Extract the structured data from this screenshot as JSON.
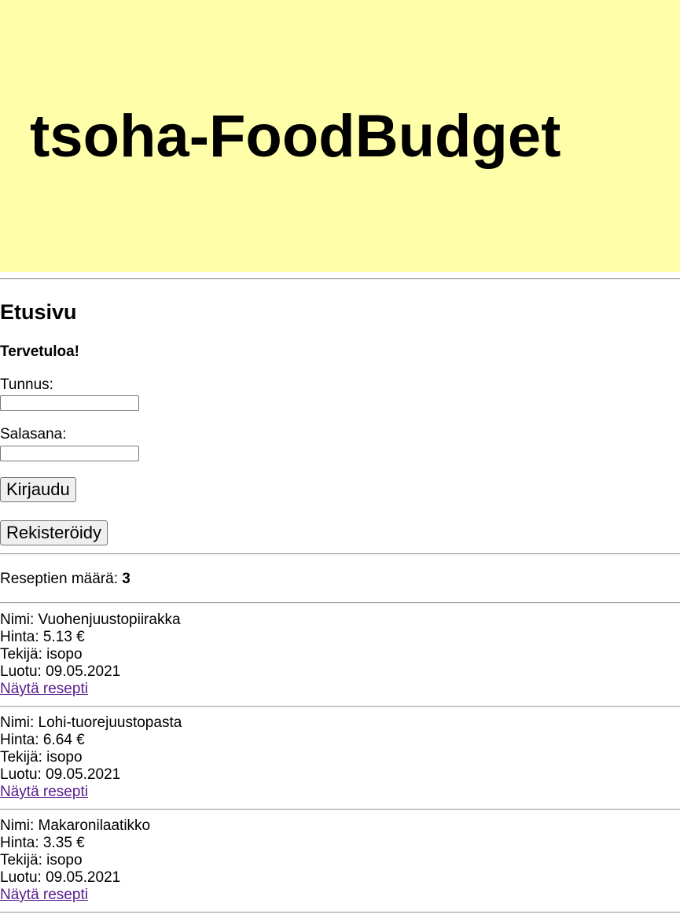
{
  "site": {
    "title": "tsoha-FoodBudget"
  },
  "page": {
    "heading": "Etusivu",
    "welcome": "Tervetuloa!"
  },
  "login": {
    "username_label": "Tunnus:",
    "username_value": "",
    "password_label": "Salasana:",
    "password_value": "",
    "login_button": "Kirjaudu",
    "register_button": "Rekisteröidy"
  },
  "recipes": {
    "count_label": "Reseptien määrä:",
    "count": "3",
    "items": [
      {
        "name": "Nimi: Vuohenjuustopiirakka",
        "price": "Hinta: 5.13 €",
        "author": "Tekijä: isopo",
        "created": "Luotu: 09.05.2021",
        "link": "Näytä resepti"
      },
      {
        "name": "Nimi: Lohi-tuorejuustopasta",
        "price": "Hinta: 6.64 €",
        "author": "Tekijä: isopo",
        "created": "Luotu: 09.05.2021",
        "link": "Näytä resepti"
      },
      {
        "name": "Nimi: Makaronilaatikko",
        "price": "Hinta: 3.35 €",
        "author": "Tekijä: isopo",
        "created": "Luotu: 09.05.2021",
        "link": "Näytä resepti"
      }
    ]
  },
  "colors": {
    "banner": "#ffffaa",
    "visited_link": "#551a8b"
  }
}
